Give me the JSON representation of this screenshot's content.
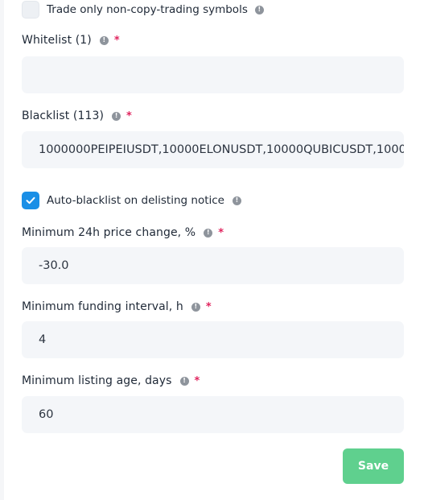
{
  "form": {
    "non_copy_label": "Trade only non-copy-trading symbols",
    "non_copy_checked": false,
    "whitelist_label": "Whitelist (1)",
    "whitelist_value": "",
    "blacklist_label": "Blacklist (113)",
    "blacklist_value": "1000000PEIPEIUSDT,10000ELONUSDT,10000QUBICUSDT,1000",
    "auto_blacklist_label": "Auto-blacklist on delisting notice",
    "auto_blacklist_checked": true,
    "min_price_change_label": "Minimum 24h price change, %",
    "min_price_change_value": "-30.0",
    "min_funding_label": "Minimum funding interval, h",
    "min_funding_value": "4",
    "min_listing_age_label": "Minimum listing age, days",
    "min_listing_age_value": "60",
    "required_mark": "*",
    "save_label": "Save"
  },
  "colors": {
    "accent": "#1a8fe6",
    "save": "#5fd08e",
    "required": "#e0245e",
    "field_bg": "#f4f6f9"
  },
  "icons": [
    "info-icon",
    "checkmark-icon"
  ]
}
